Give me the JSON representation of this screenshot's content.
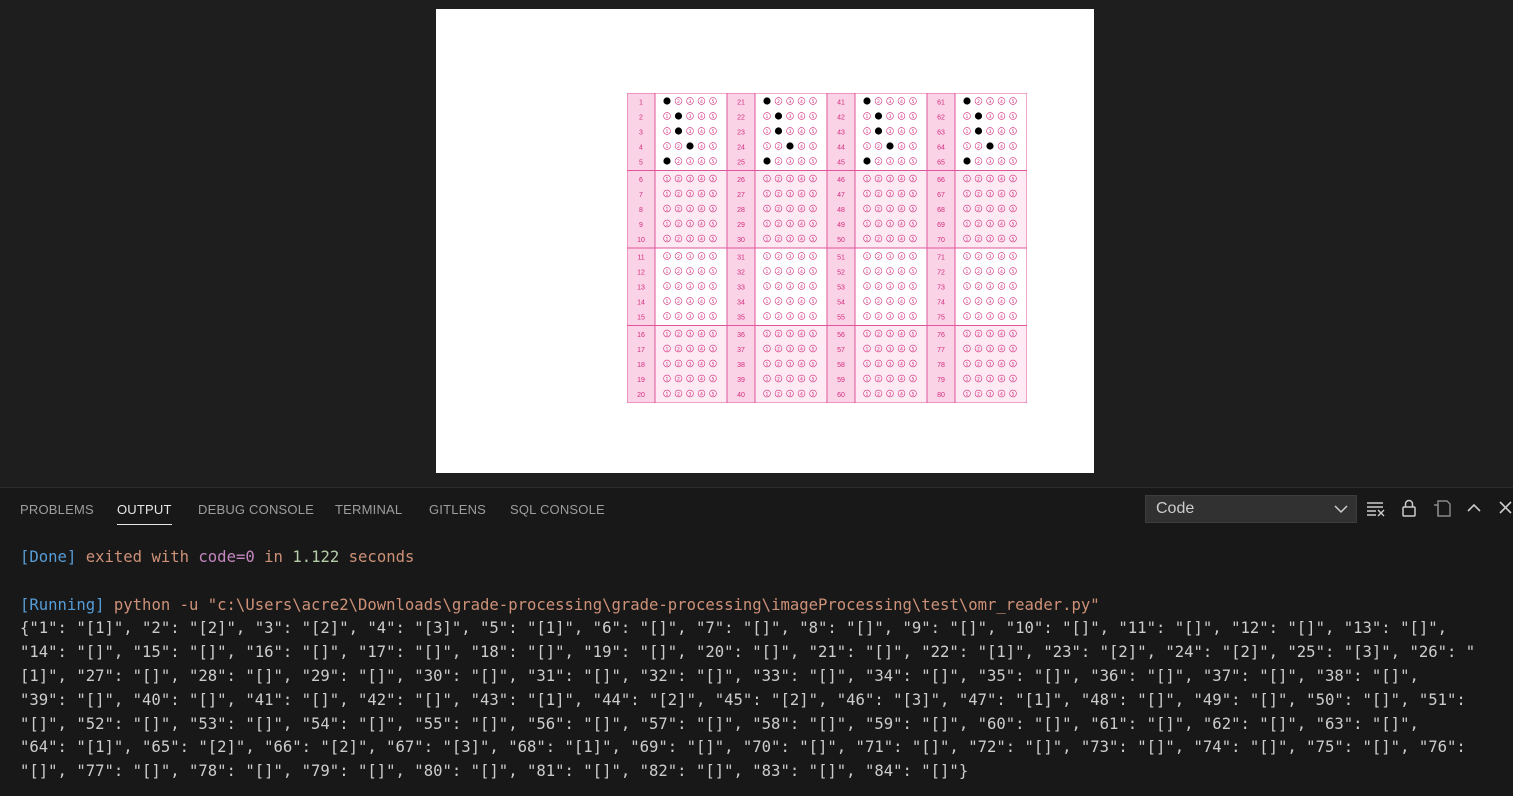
{
  "omr": {
    "rows_labels": [
      [
        1,
        2,
        3,
        4,
        5
      ],
      [
        6,
        7,
        8,
        9,
        10
      ],
      [
        11,
        12,
        13,
        14,
        15
      ],
      [
        16,
        17,
        18,
        19,
        20
      ],
      [
        21,
        22,
        23,
        24,
        25
      ],
      [
        26,
        27,
        28,
        29,
        30
      ],
      [
        31,
        32,
        33,
        34,
        35
      ],
      [
        36,
        37,
        38,
        39,
        40
      ],
      [
        41,
        42,
        43,
        44,
        45
      ],
      [
        46,
        47,
        48,
        49,
        50
      ],
      [
        51,
        52,
        53,
        54,
        55
      ],
      [
        56,
        57,
        58,
        59,
        60
      ],
      [
        61,
        62,
        63,
        64,
        65
      ],
      [
        66,
        67,
        68,
        69,
        70
      ],
      [
        71,
        72,
        73,
        74,
        75
      ],
      [
        76,
        77,
        78,
        79,
        80
      ]
    ],
    "bubble_glyphs": [
      "①",
      "②",
      "③",
      "④",
      "⑤"
    ],
    "filled_answers": {
      "1": 1,
      "2": 2,
      "3": 2,
      "4": 3,
      "5": 1,
      "21": 1,
      "22": 2,
      "23": 2,
      "24": 3,
      "25": 1,
      "41": 1,
      "42": 2,
      "43": 2,
      "44": 3,
      "45": 1,
      "61": 1,
      "62": 2,
      "63": 2,
      "64": 3,
      "65": 1
    },
    "colors": {
      "border": "#e0559a",
      "label_bg": "#fbd3e6",
      "cell_bg": "#ffffff",
      "alt_bg": "#fdeaf3",
      "text": "#d22c7e"
    }
  },
  "panel": {
    "tabs": [
      "PROBLEMS",
      "OUTPUT",
      "DEBUG CONSOLE",
      "TERMINAL",
      "GITLENS",
      "SQL CONSOLE"
    ],
    "active_tab": "OUTPUT",
    "channel": "Code",
    "output": {
      "done_tag": "[Done]",
      "done_text1": " exited with ",
      "done_code": "code=0",
      "done_in": " in ",
      "done_time": "1.122",
      "done_seconds": " seconds",
      "running_tag": "[Running]",
      "running_cmd": " python -u \"c:\\Users\\acre2\\Downloads\\grade-processing\\grade-processing\\imageProcessing\\test\\omr_reader.py\"",
      "json_lines": [
        "{\"1\": \"[1]\", \"2\": \"[2]\", \"3\": \"[2]\", \"4\": \"[3]\", \"5\": \"[1]\", \"6\": \"[]\", \"7\": \"[]\", \"8\": \"[]\", \"9\": \"[]\", \"10\": \"[]\", \"11\": \"[]\", \"12\": \"[]\", \"13\": \"[]\",",
        "\"14\": \"[]\", \"15\": \"[]\", \"16\": \"[]\", \"17\": \"[]\", \"18\": \"[]\", \"19\": \"[]\", \"20\": \"[]\", \"21\": \"[]\", \"22\": \"[1]\", \"23\": \"[2]\", \"24\": \"[2]\", \"25\": \"[3]\", \"26\": \"",
        "[1]\", \"27\": \"[]\", \"28\": \"[]\", \"29\": \"[]\", \"30\": \"[]\", \"31\": \"[]\", \"32\": \"[]\", \"33\": \"[]\", \"34\": \"[]\", \"35\": \"[]\", \"36\": \"[]\", \"37\": \"[]\", \"38\": \"[]\",",
        "\"39\": \"[]\", \"40\": \"[]\", \"41\": \"[]\", \"42\": \"[]\", \"43\": \"[1]\", \"44\": \"[2]\", \"45\": \"[2]\", \"46\": \"[3]\", \"47\": \"[1]\", \"48\": \"[]\", \"49\": \"[]\", \"50\": \"[]\", \"51\":",
        "\"[]\", \"52\": \"[]\", \"53\": \"[]\", \"54\": \"[]\", \"55\": \"[]\", \"56\": \"[]\", \"57\": \"[]\", \"58\": \"[]\", \"59\": \"[]\", \"60\": \"[]\", \"61\": \"[]\", \"62\": \"[]\", \"63\": \"[]\",",
        "\"64\": \"[1]\", \"65\": \"[2]\", \"66\": \"[2]\", \"67\": \"[3]\", \"68\": \"[1]\", \"69\": \"[]\", \"70\": \"[]\", \"71\": \"[]\", \"72\": \"[]\", \"73\": \"[]\", \"74\": \"[]\", \"75\": \"[]\", \"76\":",
        "\"[]\", \"77\": \"[]\", \"78\": \"[]\", \"79\": \"[]\", \"80\": \"[]\", \"81\": \"[]\", \"82\": \"[]\", \"83\": \"[]\", \"84\": \"[]\"}"
      ]
    }
  },
  "colors": {
    "background": "#1e1e1e",
    "panel": "#181818",
    "blue": "#569cd6",
    "orange": "#ce9178"
  }
}
